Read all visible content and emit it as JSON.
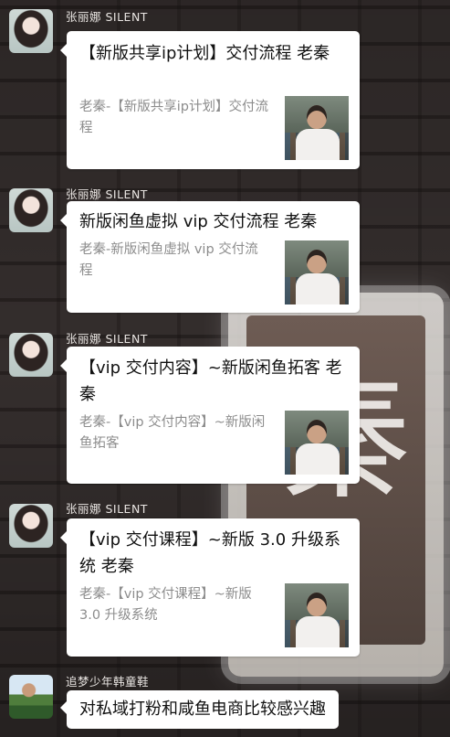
{
  "messages": [
    {
      "sender": "张丽娜 SILENT",
      "title": "【新版共享ip计划】交付流程 老秦",
      "desc": "老秦-【新版共享ip计划】交付流程"
    },
    {
      "sender": "张丽娜 SILENT",
      "title": "新版闲鱼虚拟 vip 交付流程 老秦",
      "desc": "老秦-新版闲鱼虚拟 vip 交付流程"
    },
    {
      "sender": "张丽娜 SILENT",
      "title": "【vip 交付内容】~新版闲鱼拓客 老秦",
      "desc": "老秦-【vip 交付内容】~新版闲鱼拓客"
    },
    {
      "sender": "张丽娜 SILENT",
      "title": "【vip 交付课程】~新版 3.0 升级系统 老秦",
      "desc": "老秦-【vip 交付课程】~新版 3.0 升级系统"
    },
    {
      "sender": "追梦少年韩童鞋",
      "text": "对私域打粉和咸鱼电商比较感兴趣"
    }
  ],
  "background_sign_char": "秦",
  "icons": {
    "link_thumbnail": "person-photo-icon",
    "sender_avatar": "avatar-icon"
  }
}
